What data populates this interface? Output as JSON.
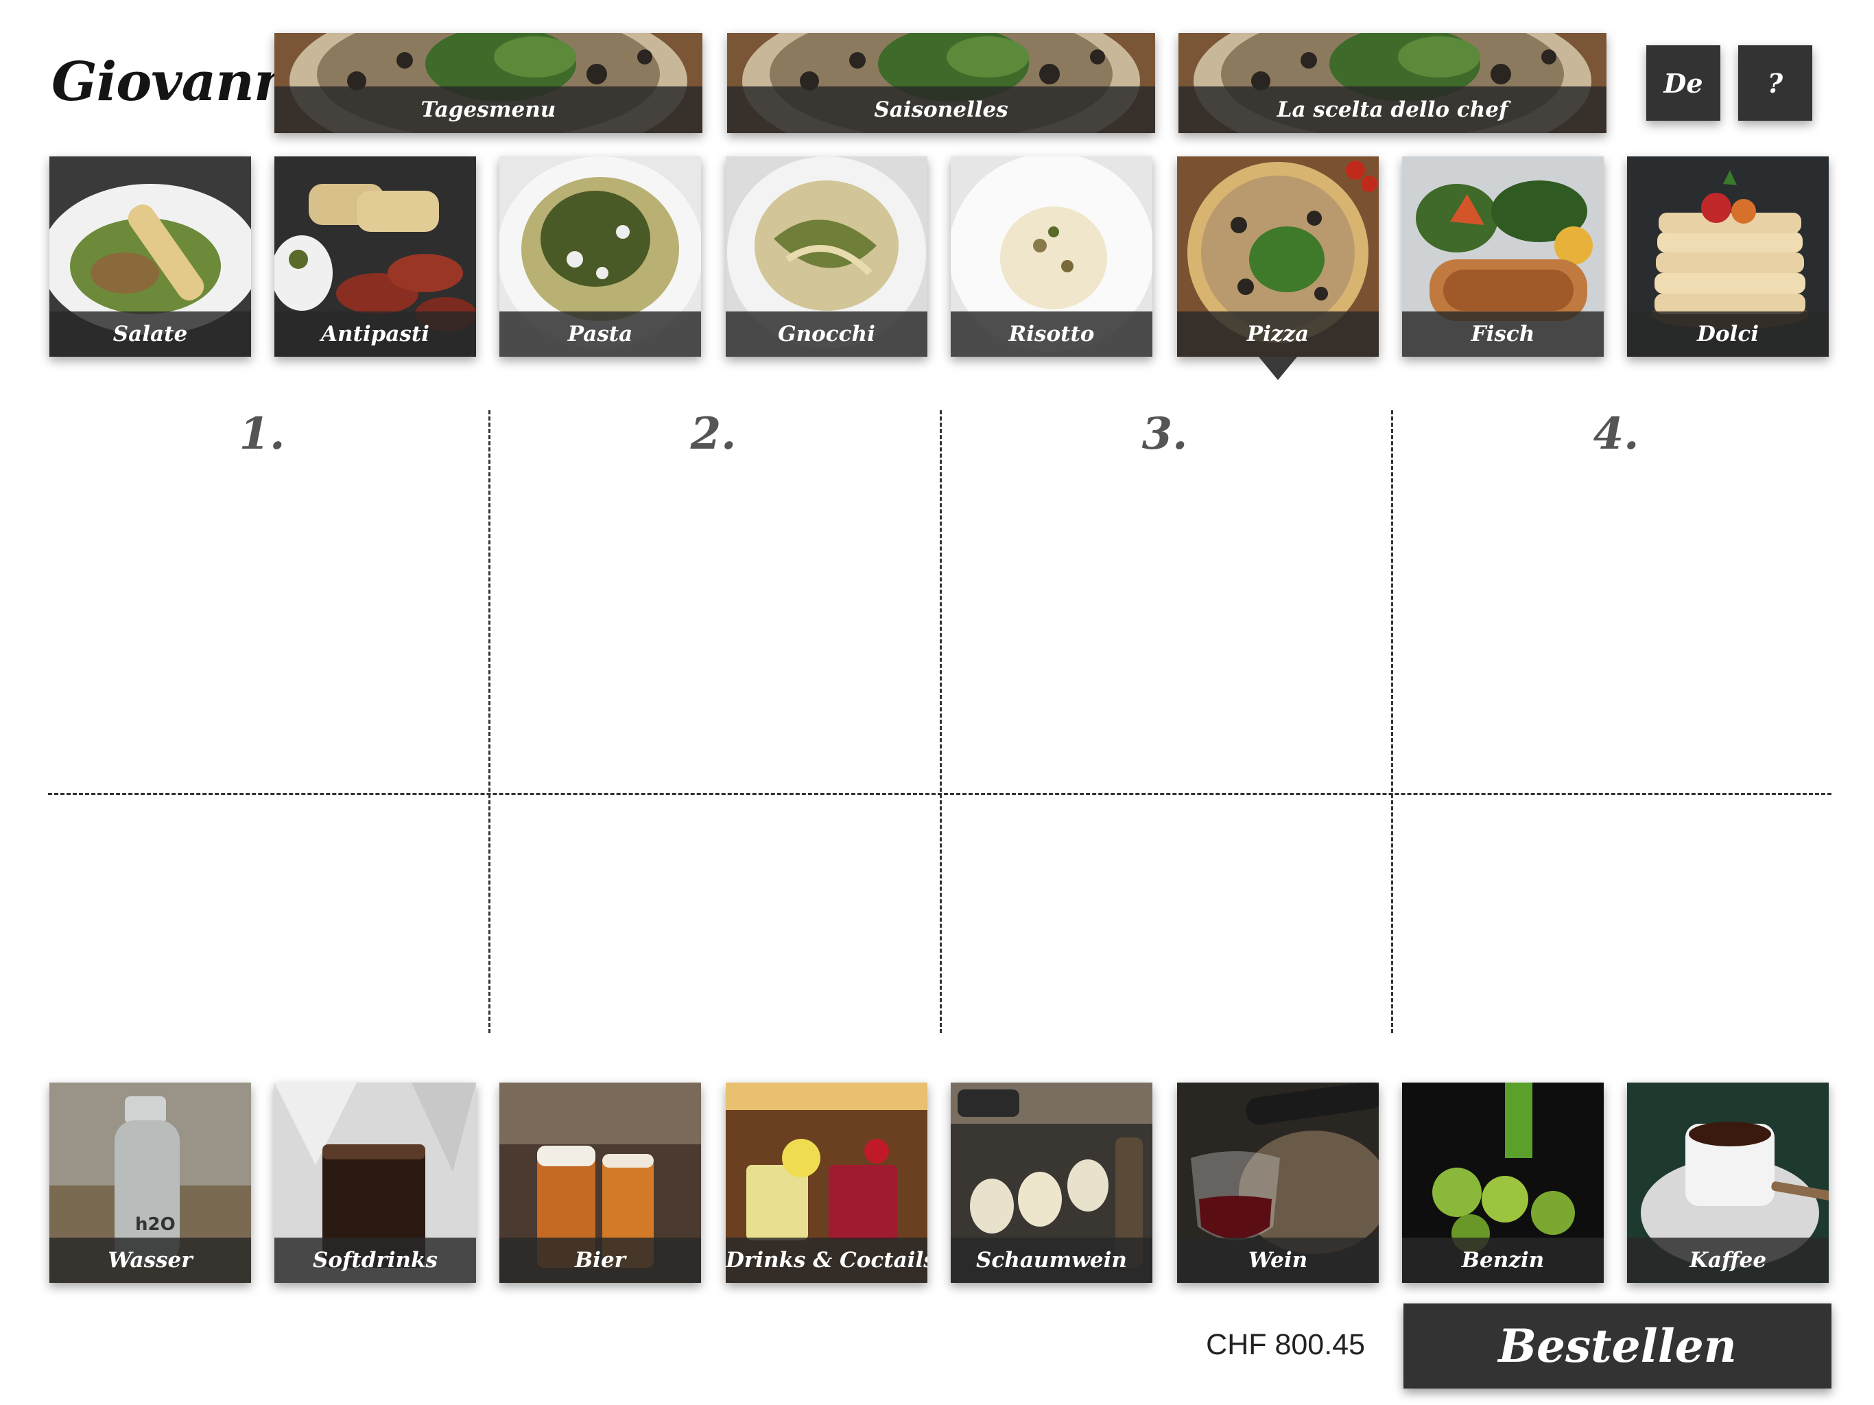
{
  "app": {
    "logo": "Giovanni"
  },
  "header": {
    "banners": [
      {
        "label": "Tagesmenu"
      },
      {
        "label": "Saisonelles"
      },
      {
        "label": "La scelta dello chef"
      }
    ],
    "language_label": "De",
    "help_label": "?"
  },
  "categories": [
    {
      "label": "Salate"
    },
    {
      "label": "Antipasti"
    },
    {
      "label": "Pasta"
    },
    {
      "label": "Gnocchi"
    },
    {
      "label": "Risotto"
    },
    {
      "label": "Pizza"
    },
    {
      "label": "Fisch"
    },
    {
      "label": "Dolci"
    }
  ],
  "selected_category": "Pizza",
  "courses": [
    "1.",
    "2.",
    "3.",
    "4."
  ],
  "drinks": [
    {
      "label": "Wasser"
    },
    {
      "label": "Softdrinks"
    },
    {
      "label": "Bier"
    },
    {
      "label": "Drinks & Coctails"
    },
    {
      "label": "Schaumwein"
    },
    {
      "label": "Wein"
    },
    {
      "label": "Benzin"
    },
    {
      "label": "Kaffee"
    }
  ],
  "footer": {
    "total": "CHF 800.45",
    "order_label": "Bestellen"
  }
}
